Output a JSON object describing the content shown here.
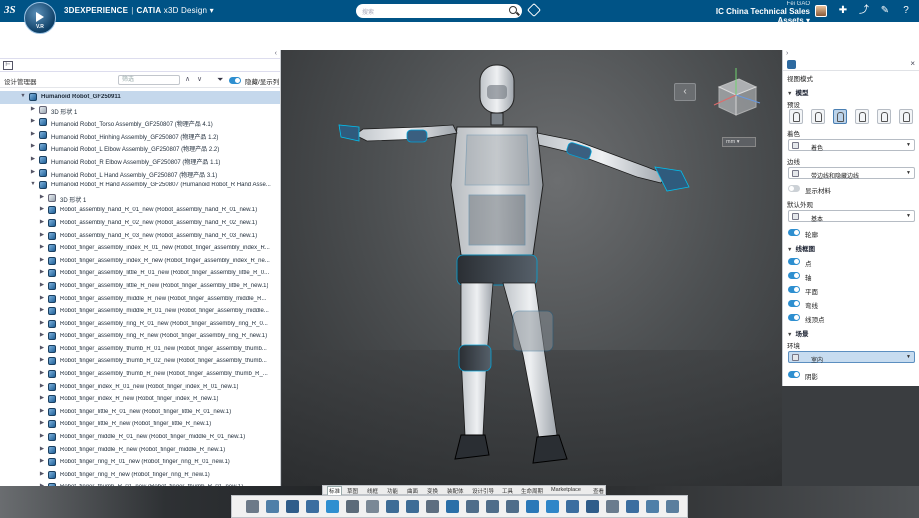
{
  "topbar": {
    "ds_logo": "3S",
    "compass_version": "V.R",
    "brand_3d": "3DEXPERIENCE",
    "brand_sep": "|",
    "brand_catia": "CATIA",
    "app_name": "x3D Design",
    "search_placeholder": "搜索",
    "user_name": "Fei GAO",
    "tenant": "IC China Technical Sales Assets",
    "colors": {
      "bar": "#005386",
      "accent": "#2e8fd0"
    }
  },
  "left_panel": {
    "title": "设计管理器",
    "filter_placeholder": "筛选",
    "hide_label": "隐藏/显示列",
    "tree": [
      {
        "level": 0,
        "expander": "▼",
        "icon": "product",
        "label": "Humanoid Robot_GF250911",
        "root": true
      },
      {
        "level": 1,
        "expander": "▶",
        "icon": "shape",
        "label": "3D 形状 1"
      },
      {
        "level": 1,
        "expander": "▶",
        "icon": "product",
        "label": "Humanoid Robot_Torso Assembly_GF250807 (物理产品 4.1)"
      },
      {
        "level": 1,
        "expander": "▶",
        "icon": "product",
        "label": "Humanoid Robot_Hinhing Assembly_GF250807 (物理产品 1.2)"
      },
      {
        "level": 1,
        "expander": "▶",
        "icon": "product",
        "label": "Humanoid Robot_L Elbow Assembly_GF250807 (物理产品 2.2)"
      },
      {
        "level": 1,
        "expander": "▶",
        "icon": "product",
        "label": "Humanoid Robot_R Elbow Assembly_GF250807 (物理产品 1.1)"
      },
      {
        "level": 1,
        "expander": "▶",
        "icon": "product",
        "label": "Humanoid Robot_L Hand Assembly_GF250807 (物理产品 3.1)"
      },
      {
        "level": 1,
        "expander": "▼",
        "icon": "product",
        "label": "Humanoid Robot_R Hand Assembly_GF250807 (Humanoid Robot_R Hand Asse..."
      },
      {
        "level": 2,
        "expander": "▶",
        "icon": "shape",
        "label": "3D 形状 1"
      },
      {
        "level": 2,
        "expander": "▶",
        "icon": "product",
        "label": "Robot_assembly_hand_R_01_new (Robot_assembly_hand_R_01_new.1)"
      },
      {
        "level": 2,
        "expander": "▶",
        "icon": "product",
        "label": "Robot_assembly_hand_R_02_new (Robot_assembly_hand_R_02_new.1)"
      },
      {
        "level": 2,
        "expander": "▶",
        "icon": "product",
        "label": "Robot_assembly_hand_R_03_new (Robot_assembly_hand_R_03_new.1)"
      },
      {
        "level": 2,
        "expander": "▶",
        "icon": "product",
        "label": "Robot_finger_assembly_index_R_01_new (Robot_finger_assembly_index_R..."
      },
      {
        "level": 2,
        "expander": "▶",
        "icon": "product",
        "label": "Robot_finger_assembly_index_R_new (Robot_finger_assembly_index_R_ne..."
      },
      {
        "level": 2,
        "expander": "▶",
        "icon": "product",
        "label": "Robot_finger_assembly_little_R_01_new (Robot_finger_assembly_little_R_0..."
      },
      {
        "level": 2,
        "expander": "▶",
        "icon": "product",
        "label": "Robot_finger_assembly_little_R_new (Robot_finger_assembly_little_R_new.1)"
      },
      {
        "level": 2,
        "expander": "▶",
        "icon": "product",
        "label": "Robot_finger_assembly_middle_R_new (Robot_finger_assembly_middle_R..."
      },
      {
        "level": 2,
        "expander": "▶",
        "icon": "product",
        "label": "Robot_finger_assembly_middle_R_01_new (Robot_finger_assembly_middle..."
      },
      {
        "level": 2,
        "expander": "▶",
        "icon": "product",
        "label": "Robot_finger_assembly_ring_R_01_new (Robot_finger_assembly_ring_R_0..."
      },
      {
        "level": 2,
        "expander": "▶",
        "icon": "product",
        "label": "Robot_finger_assembly_ring_R_new (Robot_finger_assembly_ring_R_new.1)"
      },
      {
        "level": 2,
        "expander": "▶",
        "icon": "product",
        "label": "Robot_finger_assembly_thumb_R_01_new (Robot_finger_assembly_thumb..."
      },
      {
        "level": 2,
        "expander": "▶",
        "icon": "product",
        "label": "Robot_finger_assembly_thumb_R_02_new (Robot_finger_assembly_thumb..."
      },
      {
        "level": 2,
        "expander": "▶",
        "icon": "product",
        "label": "Robot_finger_assembly_thumb_R_new (Robot_finger_assembly_thumb_R_..."
      },
      {
        "level": 2,
        "expander": "▶",
        "icon": "product",
        "label": "Robot_finger_index_R_01_new (Robot_finger_index_R_01_new.1)"
      },
      {
        "level": 2,
        "expander": "▶",
        "icon": "product",
        "label": "Robot_finger_index_R_new (Robot_finger_index_R_new.1)"
      },
      {
        "level": 2,
        "expander": "▶",
        "icon": "product",
        "label": "Robot_finger_little_R_01_new (Robot_finger_little_R_01_new.1)"
      },
      {
        "level": 2,
        "expander": "▶",
        "icon": "product",
        "label": "Robot_finger_little_R_new (Robot_finger_little_R_new.1)"
      },
      {
        "level": 2,
        "expander": "▶",
        "icon": "product",
        "label": "Robot_finger_middle_R_01_new (Robot_finger_middle_R_01_new.1)"
      },
      {
        "level": 2,
        "expander": "▶",
        "icon": "product",
        "label": "Robot_finger_middle_R_new (Robot_finger_middle_R_new.1)"
      },
      {
        "level": 2,
        "expander": "▶",
        "icon": "product",
        "label": "Robot_finger_ring_R_01_new (Robot_finger_ring_R_01_new.1)"
      },
      {
        "level": 2,
        "expander": "▶",
        "icon": "product",
        "label": "Robot_finger_ring_R_new (Robot_finger_ring_R_new.1)"
      },
      {
        "level": 2,
        "expander": "▶",
        "icon": "product",
        "label": "Robot_finger_thumb_R_01_new (Robot_finger_thumb_R_01_new.1)"
      }
    ]
  },
  "viewport": {
    "unit": "mm"
  },
  "right_panel": {
    "title": "视图模式",
    "section_model": "模型",
    "preset_label": "预设",
    "presets": [
      "preset-1",
      "preset-2",
      "preset-3",
      "preset-4",
      "preset-5",
      "preset-6"
    ],
    "preset_selected": 2,
    "color_label": "着色",
    "color_value": "着色",
    "edge_label": "边线",
    "edge_value": "带边线和隐藏边线",
    "show_material": "显示材料",
    "default_look_label": "默认外观",
    "default_look_value": "基本",
    "outline": "轮廓",
    "section_wire": "线框图",
    "wire_items": [
      "点",
      "轴",
      "平面",
      "弯线",
      "线顶点"
    ],
    "section_scene": "场景",
    "env_label": "环境",
    "env_value": "室内",
    "shadow": "阴影"
  },
  "bottom": {
    "tabs": [
      "标准",
      "草图",
      "线框",
      "功能",
      "曲面",
      "变换",
      "装配体",
      "设计引导",
      "工具",
      "生命周期",
      "Marketplace",
      "查看"
    ],
    "active_tab": 0
  }
}
